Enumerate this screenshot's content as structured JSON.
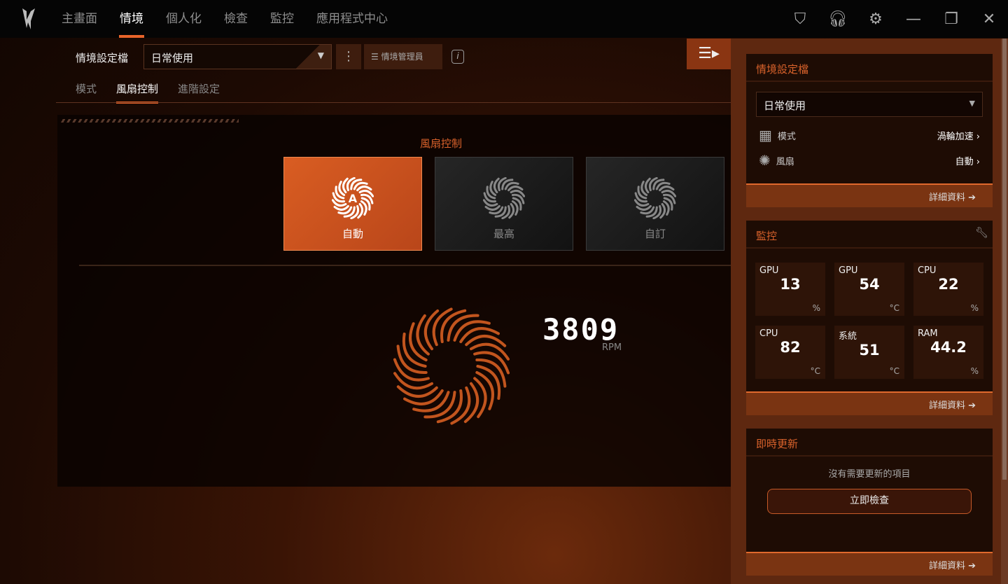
{
  "nav": {
    "items": [
      "主畫面",
      "情境",
      "個人化",
      "檢查",
      "監控",
      "應用程式中心"
    ],
    "active": 1
  },
  "window_icons": [
    "shield-icon",
    "headset-icon",
    "gear-icon",
    "minimize-icon",
    "restore-icon",
    "close-icon"
  ],
  "profile": {
    "label": "情境設定檔",
    "value": "日常使用",
    "manager": "情境管理員"
  },
  "subtabs": {
    "items": [
      "模式",
      "風扇控制",
      "進階設定"
    ],
    "active": 1
  },
  "fan_control": {
    "title": "風扇控制",
    "options": [
      {
        "label": "自動",
        "selected": true,
        "icon": "fan-auto-icon"
      },
      {
        "label": "最高",
        "selected": false,
        "icon": "fan-max-icon"
      },
      {
        "label": "自訂",
        "selected": false,
        "icon": "fan-custom-icon"
      }
    ],
    "rpm": "3809",
    "rpm_unit": "RPM"
  },
  "sidebar": {
    "profile_panel": {
      "title": "情境設定檔",
      "value": "日常使用",
      "mode_label": "模式",
      "mode_value": "渦輪加速",
      "fan_label": "風扇",
      "fan_value": "自動",
      "details": "詳細資料"
    },
    "monitor": {
      "title": "監控",
      "details": "詳細資料",
      "tiles": [
        {
          "name": "GPU",
          "value": "13",
          "unit": "%"
        },
        {
          "name": "GPU",
          "value": "54",
          "unit": "°C"
        },
        {
          "name": "CPU",
          "value": "22",
          "unit": "%"
        },
        {
          "name": "CPU",
          "value": "82",
          "unit": "°C"
        },
        {
          "name": "系統",
          "value": "51",
          "unit": "°C"
        },
        {
          "name": "RAM",
          "value": "44.2",
          "unit": "%"
        }
      ]
    },
    "update": {
      "title": "即時更新",
      "message": "沒有需要更新的項目",
      "check": "立即檢查",
      "details": "詳細資料"
    }
  },
  "colors": {
    "accent": "#e8642a"
  }
}
